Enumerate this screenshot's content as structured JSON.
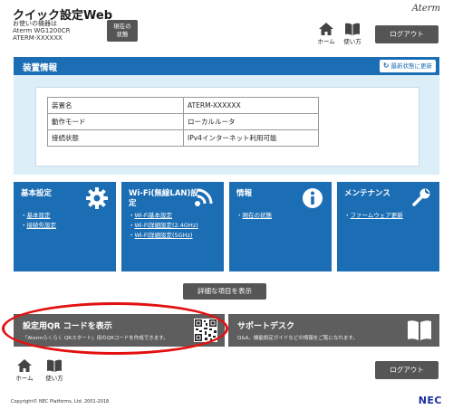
{
  "header": {
    "title": "クイック設定Web",
    "model_caption": "お使いの機器は",
    "model_name": "Aterm WG1200CR",
    "device_name": "ATERM-XXXXXX",
    "status_button": [
      "現在の",
      "状態"
    ],
    "logo": "Aterm",
    "home_label": "ホーム",
    "help_label": "使い方",
    "logout_label": "ログアウト"
  },
  "device_info": {
    "title": "装置情報",
    "refresh_label": "最新状態に更新",
    "rows": [
      {
        "key": "装置名",
        "value": "ATERM-XXXXXX"
      },
      {
        "key": "動作モード",
        "value": "ローカルルータ"
      },
      {
        "key": "接続状態",
        "value": "IPv4インターネット利用可能"
      }
    ]
  },
  "tiles": [
    {
      "title": "基本設定",
      "icon": "gear-icon",
      "links": [
        "基本設定",
        "接続先設定"
      ]
    },
    {
      "title": "Wi-Fi(無線LAN)設定",
      "icon": "wifi-icon",
      "links": [
        "Wi-Fi基本設定",
        "Wi-Fi詳細設定(2.4GHz)",
        "Wi-Fi詳細設定(5GHz)"
      ]
    },
    {
      "title": "情報",
      "icon": "info-icon",
      "links": [
        "現在の状態"
      ]
    },
    {
      "title": "メンテナンス",
      "icon": "wrench-icon",
      "links": [
        "ファームウェア更新"
      ]
    }
  ],
  "detail_button": "詳細な項目を表示",
  "qr_button": {
    "title": "設定用QR コードを表示",
    "subtitle": "「Atermらくらく QRスタート」用のQRコードを作成できます。"
  },
  "support_button": {
    "title": "サポートデスク",
    "subtitle": "Q&A、機能設定ガイドなどの情報をご覧になれます。"
  },
  "footer": {
    "home_label": "ホーム",
    "help_label": "使い方",
    "logout_label": "ログアウト",
    "copyright": "Copyright© NEC Platforms, Ltd. 2001-2018",
    "nec_logo": "NEC"
  },
  "colors": {
    "primary": "#1c6eb4",
    "panel": "#dceef8",
    "button": "#555555",
    "highlight": "#e31010"
  }
}
